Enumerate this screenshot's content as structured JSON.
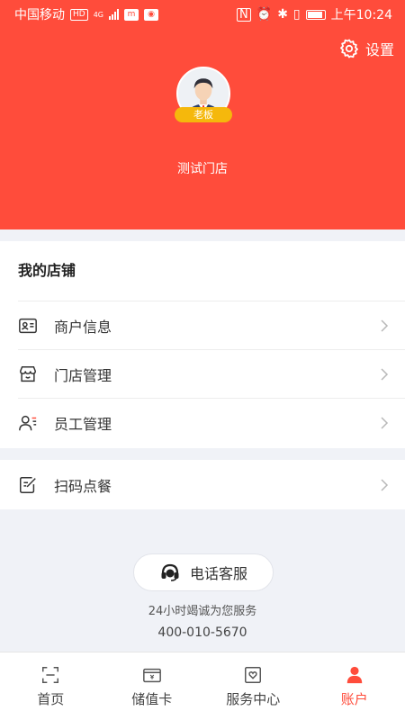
{
  "status_bar": {
    "carrier": "中国移动",
    "hd_badge": "HD",
    "network": "4G",
    "time": "上午10:24",
    "icons": [
      "nfc-icon",
      "alarm-icon",
      "bluetooth-icon",
      "vibrate-icon",
      "battery-icon"
    ]
  },
  "header": {
    "settings_label": "设置",
    "role_badge": "老板",
    "store_name": "测试门店",
    "accent_color": "#ff4c3b"
  },
  "my_store": {
    "title": "我的店铺",
    "items": [
      {
        "label": "商户信息",
        "icon": "id-card-icon"
      },
      {
        "label": "门店管理",
        "icon": "storefront-icon"
      },
      {
        "label": "员工管理",
        "icon": "staff-icon"
      }
    ]
  },
  "extra": {
    "items": [
      {
        "label": "扫码点餐",
        "icon": "edit-note-icon"
      }
    ]
  },
  "service": {
    "button_label": "电话客服",
    "slogan": "24小时竭诚为您服务",
    "phone": "400-010-5670"
  },
  "tabbar": {
    "tabs": [
      {
        "label": "首页",
        "icon": "scan-frame-icon",
        "active": false
      },
      {
        "label": "储值卡",
        "icon": "wallet-card-icon",
        "active": false
      },
      {
        "label": "服务中心",
        "icon": "heart-box-icon",
        "active": false
      },
      {
        "label": "账户",
        "icon": "person-icon",
        "active": true
      }
    ]
  }
}
